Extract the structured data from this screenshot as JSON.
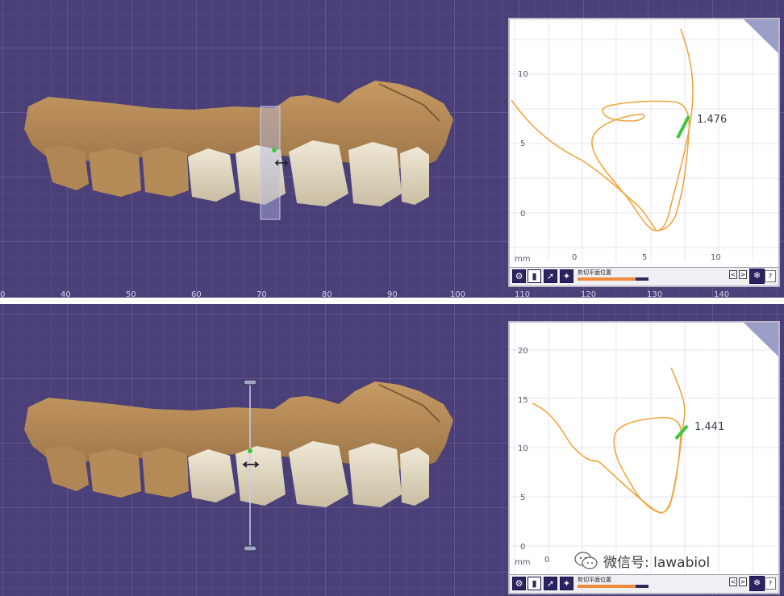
{
  "top_view": {
    "ruler_labels": [
      "0",
      "40",
      "50",
      "60",
      "70",
      "80",
      "90",
      "100",
      "110",
      "120",
      "130",
      "140"
    ],
    "panel": {
      "y_ticks": [
        "10",
        "5",
        "0"
      ],
      "x_ticks": [
        "0",
        "5",
        "10"
      ],
      "unit": "mm",
      "measurement": "1.476",
      "toolbar_label": "剪切平面位置",
      "progress_fraction": 0.82,
      "nav_prev": "<",
      "nav_next": ">",
      "help": "?"
    }
  },
  "bottom_view": {
    "panel": {
      "y_ticks": [
        "20",
        "15",
        "10",
        "5",
        "0"
      ],
      "x_ticks": [
        "0"
      ],
      "unit": "mm",
      "measurement": "1.441",
      "toolbar_label": "剪切平面位置",
      "progress_fraction": 0.82,
      "nav_prev": "<",
      "nav_next": ">",
      "help": "?"
    }
  },
  "watermark": {
    "text": "微信号: lawabiol",
    "icon": "wechat-icon"
  },
  "colors": {
    "viewport_bg": "#4b3f78",
    "grid": "#6a5fa0",
    "gum": "#b58a58",
    "tooth": "#ddd2b9",
    "curve": "#f0a640",
    "measure": "#3cc83c",
    "toolbar_accent": "#f08a3c"
  }
}
